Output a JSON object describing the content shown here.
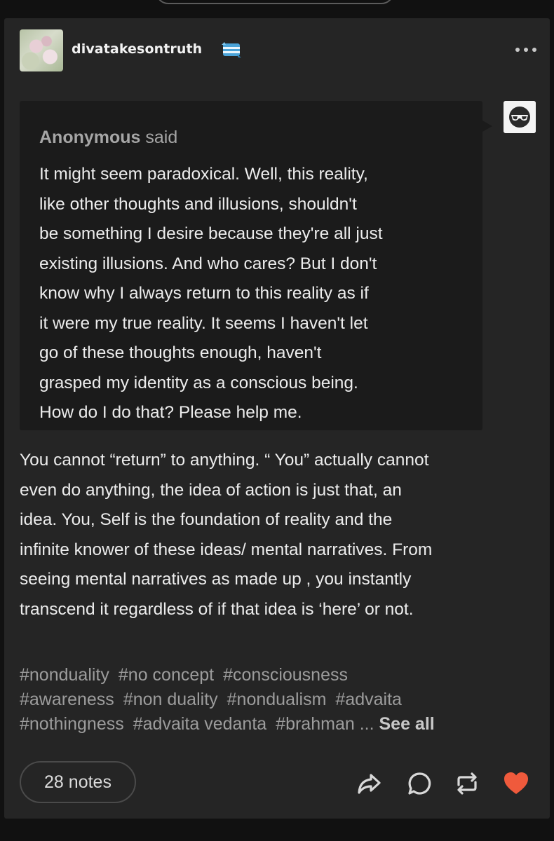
{
  "post": {
    "blog_name": "divatakesontruth",
    "ask": {
      "asker": "Anonymous",
      "said": "said",
      "lines": [
        "It might seem paradoxical. Well, this reality,",
        "like other thoughts and illusions, shouldn't",
        "be something I desire because they're all just",
        "existing illusions. And who cares? But I don't",
        "know why I always return to this reality as if",
        "it were my true reality. It seems I haven't let",
        "go of these thoughts enough, haven't",
        "grasped my identity as a conscious being.",
        "How do I do that? Please help me."
      ]
    },
    "answer_lines": [
      "You cannot “return” to anything. “ You” actually cannot",
      "even do anything, the idea of action is just that, an",
      "idea. You, Self is the foundation of reality and the",
      "infinite knower of these ideas/ mental narratives. From",
      "seeing mental narratives as made up , you instantly",
      "transcend it regardless of if that idea is ‘here’ or not."
    ],
    "tags": [
      "#nonduality",
      "#no concept",
      "#consciousness",
      "#awareness",
      "#non duality",
      "#nondualism",
      "#advaita",
      "#nothingness",
      "#advaita vedanta",
      "#brahman"
    ],
    "tags_ellipsis": "...",
    "see_all": "See all",
    "notes": "28 notes"
  },
  "icons": {
    "more": "ellipsis-horizontal-icon",
    "badge": "blog-badge-icon",
    "anon_avatar": "anonymous-avatar-icon",
    "share": "share-arrow-icon",
    "reply": "reply-bubble-icon",
    "reblog": "reblog-icon",
    "like": "heart-icon"
  },
  "colors": {
    "background": "#111111",
    "post_bg": "#252525",
    "ask_bg": "#1b1b1b",
    "text": "#ececec",
    "muted": "#9c9c9c",
    "like": "#ef5a3c",
    "badge_blue": "#4aa3d8"
  }
}
